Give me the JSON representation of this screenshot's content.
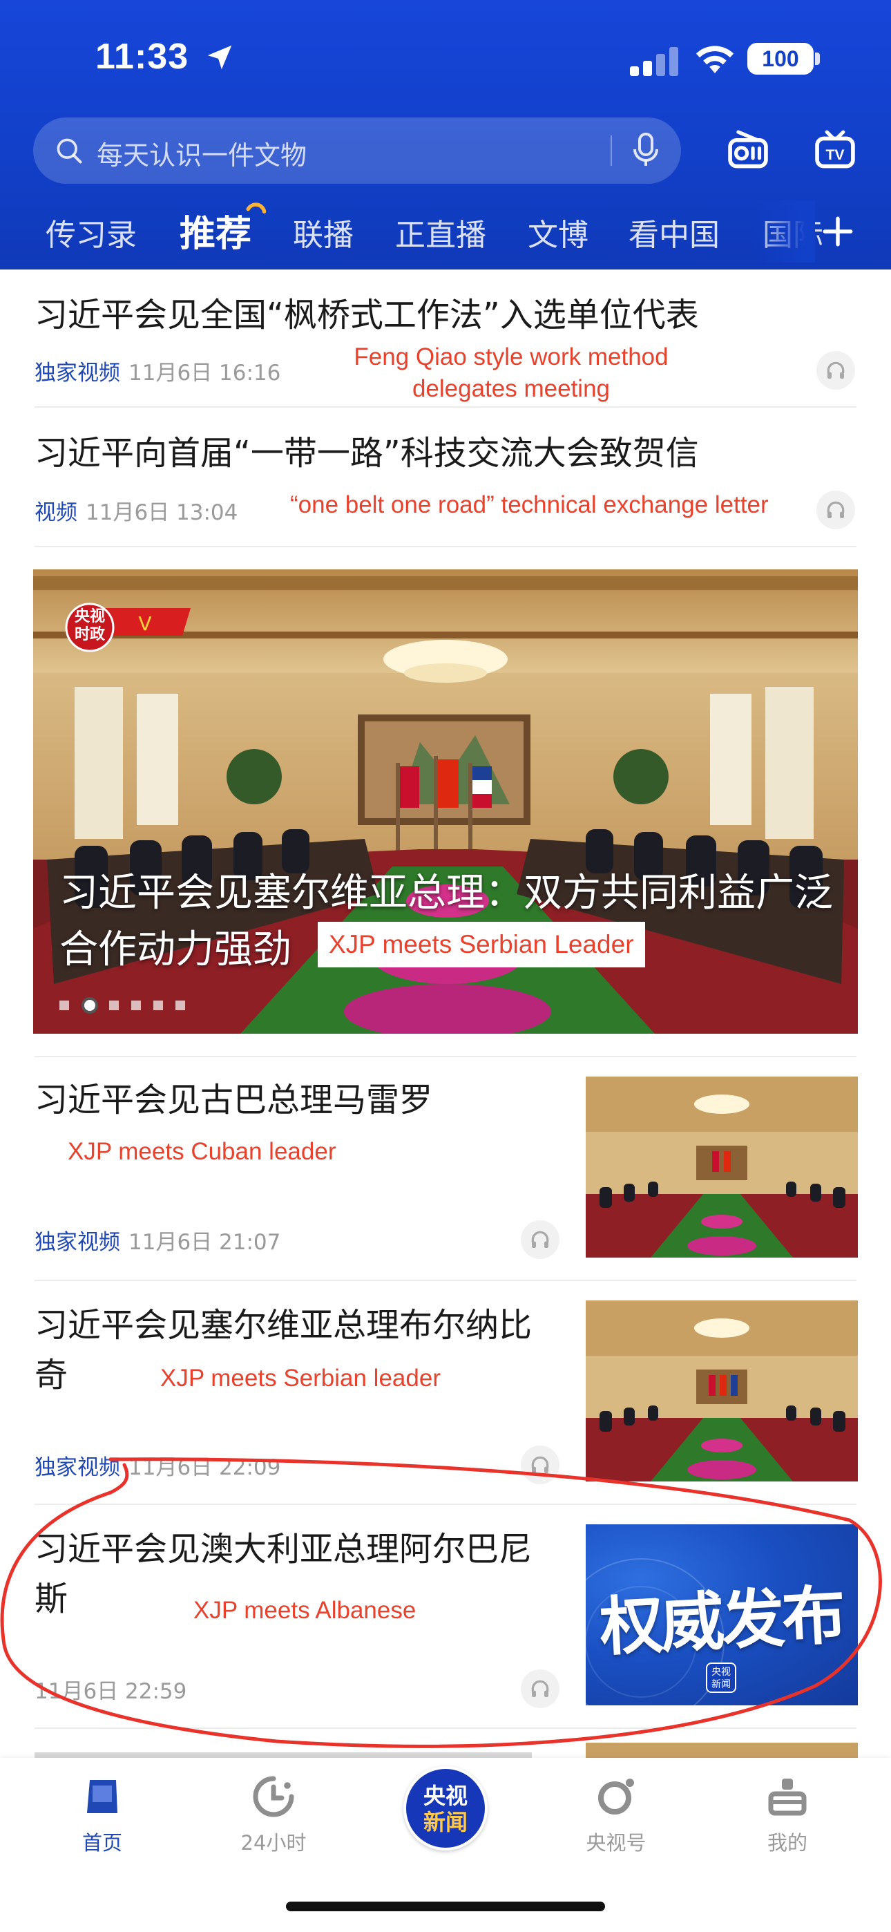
{
  "status": {
    "time": "11:33",
    "battery": "100"
  },
  "search": {
    "placeholder": "每天认识一件文物"
  },
  "tabs": [
    "传习录",
    "推荐",
    "联播",
    "正直播",
    "文博",
    "看中国",
    "国际"
  ],
  "active_tab": "推荐",
  "feed": {
    "item1": {
      "title": "习近平会见全国“枫桥式工作法”入选单位代表",
      "tag": "独家视频",
      "time": "11月6日 16:16",
      "annotation_line1": "Feng Qiao style work method",
      "annotation_line2": "delegates meeting"
    },
    "item2": {
      "title": "习近平向首届“一带一路”科技交流大会致贺信",
      "tag": "视频",
      "time": "11月6日 13:04",
      "annotation": "“one belt one road” technical exchange letter"
    },
    "banner": {
      "title": "习近平会见塞尔维亚总理：双方共同利益广泛合作动力强劲",
      "annotation": "XJP meets Serbian Leader",
      "logo_line1": "央视",
      "logo_line2": "时政"
    },
    "item3": {
      "title": "习近平会见古巴总理马雷罗",
      "annotation": "XJP meets Cuban leader",
      "tag": "独家视频",
      "time": "11月6日 21:07"
    },
    "item4": {
      "title": "习近平会见塞尔维亚总理布尔纳比奇",
      "annotation": "XJP meets Serbian leader",
      "tag": "独家视频",
      "time": "11月6日 22:09"
    },
    "item5": {
      "title": "习近平会见澳大利亚总理阿尔巴尼斯",
      "annotation": "XJP meets Albanese",
      "time": "11月6日 22:59",
      "thumb_text": "权威发布",
      "badge_line1": "央视",
      "badge_line2": "新闻"
    }
  },
  "bottom_nav": {
    "home": "首页",
    "hours24": "24小时",
    "center_line1": "央视",
    "center_line2": "新闻",
    "cctv_account": "央视号",
    "mine": "我的"
  },
  "colors": {
    "header_blue": "#1240c9",
    "accent_blue": "#1f48b5",
    "annotation_red": "#e8412c"
  }
}
